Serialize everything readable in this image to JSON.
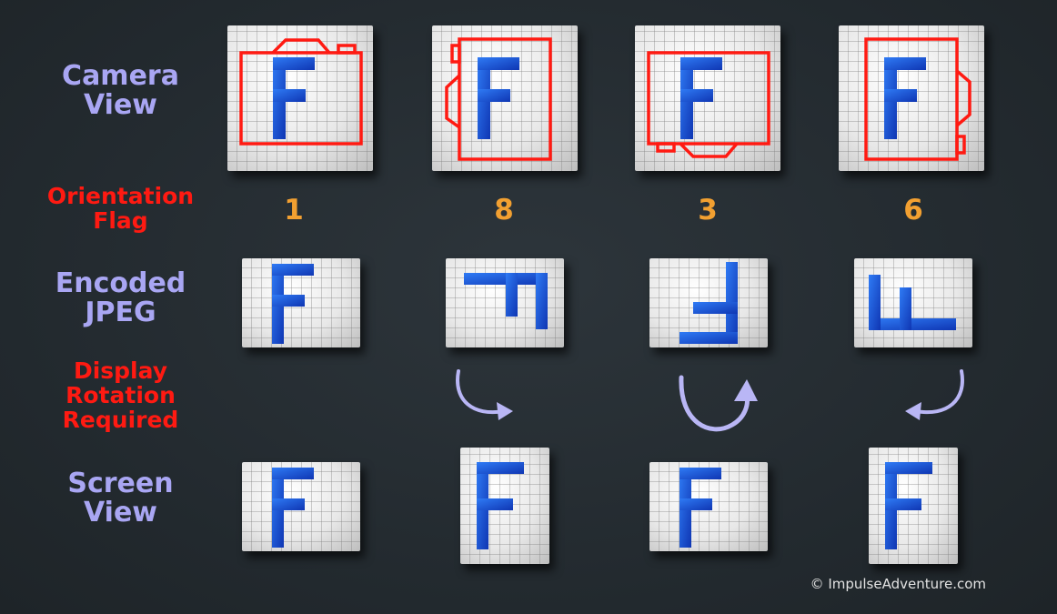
{
  "rows": {
    "camera_view": "Camera View",
    "orientation_flag": "Orientation Flag",
    "encoded_jpeg": "Encoded JPEG",
    "display_rotation": "Display Rotation Required",
    "screen_view": "Screen View"
  },
  "columns": [
    {
      "flag": "1",
      "rotation": "none"
    },
    {
      "flag": "8",
      "rotation": "clockwise-90"
    },
    {
      "flag": "3",
      "rotation": "180"
    },
    {
      "flag": "6",
      "rotation": "counterclockwise-90"
    }
  ],
  "copyright": "© ImpulseAdventure.com",
  "colors": {
    "background": "#252c31",
    "label_primary": "#a9a6f3",
    "label_secondary": "#ff1a12",
    "flag_number": "#f2a031",
    "camera_outline": "#ff1a12",
    "letter_blue": "#1f63e6",
    "arrow": "#b9b6f5"
  },
  "icons": [
    "camera-outline-icon",
    "letter-f-icon",
    "curved-arrow-icon"
  ]
}
